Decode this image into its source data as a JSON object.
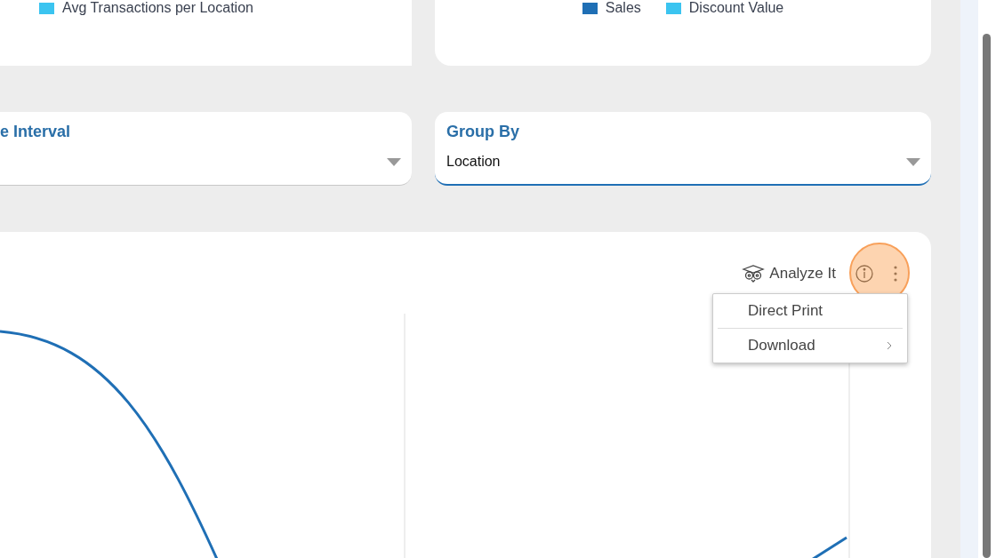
{
  "top_cards": [
    {
      "legend": [
        {
          "label": "Avg Transactions per Location",
          "color": "#3bc4f0"
        }
      ]
    },
    {
      "legend": [
        {
          "label": "Sales",
          "color": "#1f6fb5"
        },
        {
          "label": "Discount Value",
          "color": "#3bc4f0"
        }
      ]
    }
  ],
  "filters": [
    {
      "title": "e Interval",
      "focused": false
    },
    {
      "title": "Group By",
      "value": "Location",
      "focused": true
    }
  ],
  "chart_card": {
    "analyze_label": "Analyze It",
    "menu": {
      "open": true,
      "items": [
        {
          "label": "Direct Print",
          "submenu": false
        },
        {
          "label": "Download",
          "submenu": true
        }
      ]
    }
  }
}
